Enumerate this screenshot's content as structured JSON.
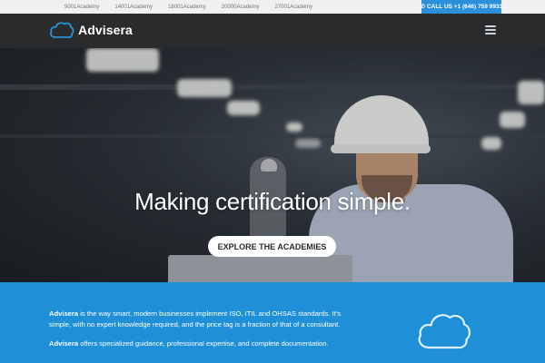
{
  "topbar": {
    "links": [
      "9001Academy",
      "14001Academy",
      "18001Academy",
      "20000Academy",
      "27001Academy"
    ],
    "call_label": "CALL US +1 (646) 759 9933"
  },
  "header": {
    "logo_text": "Advisera",
    "menu_icon": "hamburger-icon"
  },
  "hero": {
    "headline": "Making certification simple.",
    "cta_label": "EXPLORE THE ACADEMIES"
  },
  "about": {
    "p1_brand": "Advisera",
    "p1_text": " is the way smart, modern businesses implement ISO, ITIL and OHSAS standards. It's simple, with no expert knowledge required, and the price tag is a fraction of that of a consultant.",
    "p2_brand": "Advisera",
    "p2_text": " offers specialized guidance, professional expertise, and complete documentation."
  },
  "colors": {
    "accent_blue": "#1f8fd8",
    "header_dark": "#2a2b2d",
    "call_button": "#2b90d9"
  }
}
